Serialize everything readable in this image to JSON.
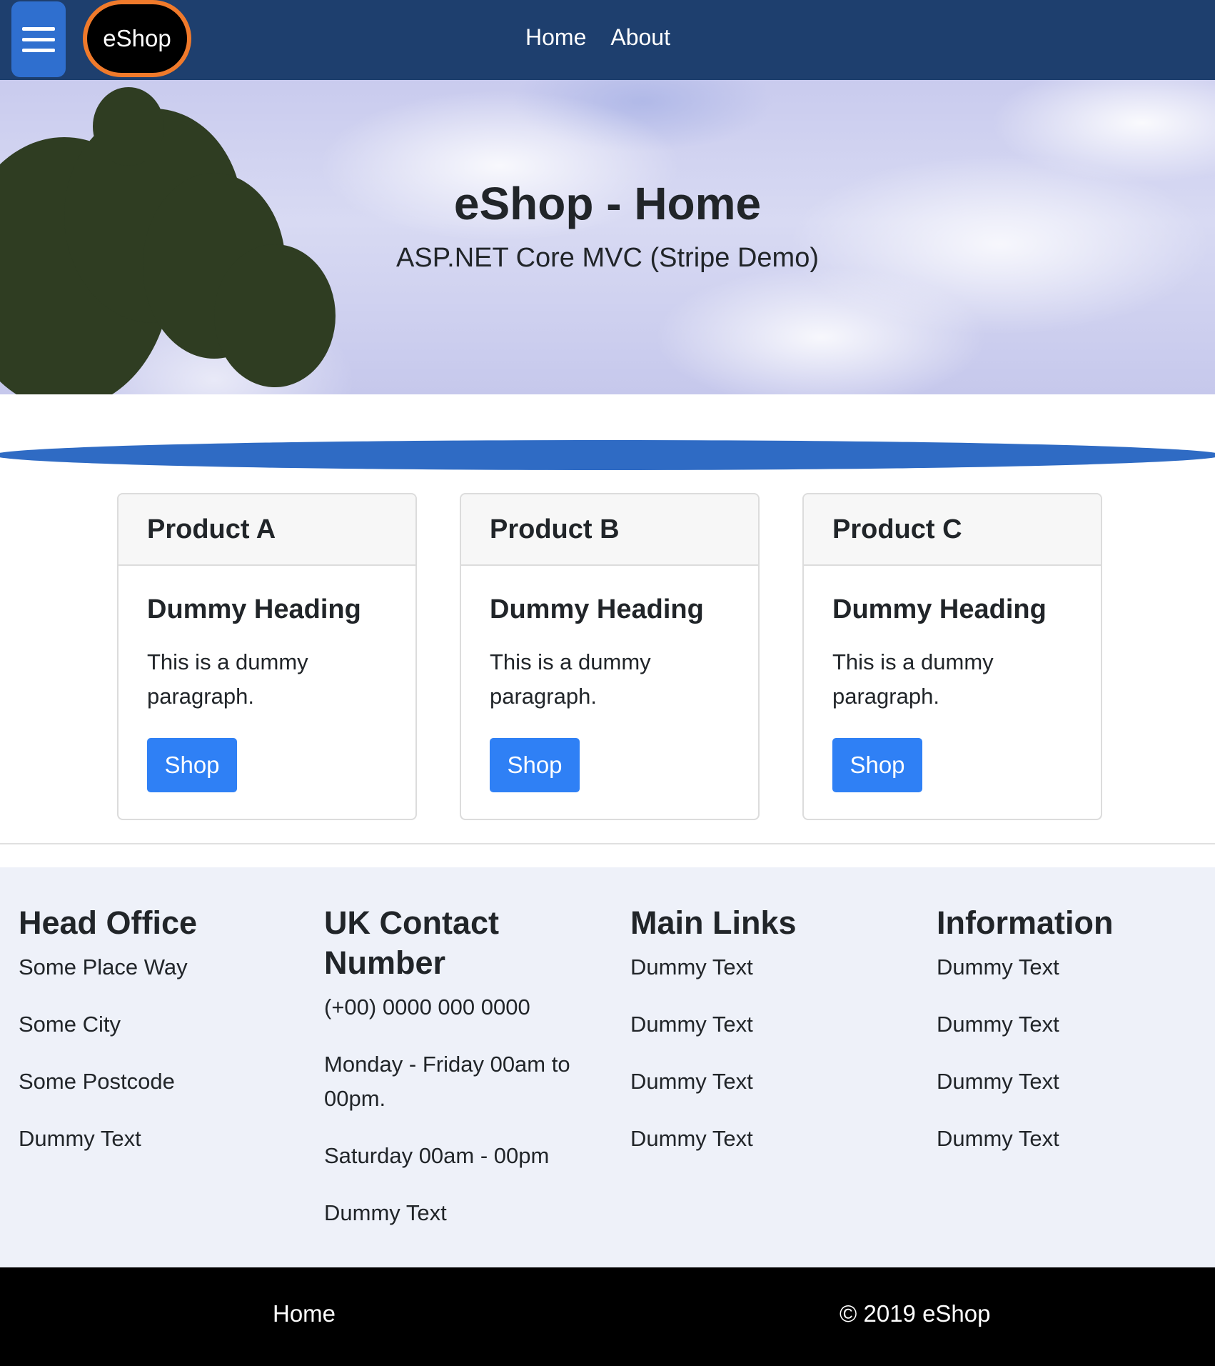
{
  "nav": {
    "brand": "eShop",
    "links": [
      "Home",
      "About"
    ]
  },
  "hero": {
    "title": "eShop - Home",
    "subtitle": "ASP.NET Core MVC (Stripe Demo)"
  },
  "products": [
    {
      "name": "Product A",
      "heading": "Dummy Heading",
      "text": "This is a dummy paragraph.",
      "button": "Shop"
    },
    {
      "name": "Product B",
      "heading": "Dummy Heading",
      "text": "This is a dummy paragraph.",
      "button": "Shop"
    },
    {
      "name": "Product C",
      "heading": "Dummy Heading",
      "text": "This is a dummy paragraph.",
      "button": "Shop"
    }
  ],
  "footer": {
    "head_office": {
      "title": "Head Office",
      "lines": [
        "Some Place Way",
        "Some City",
        "Some Postcode",
        "Dummy Text"
      ]
    },
    "contact": {
      "title": "UK Contact Number",
      "lines": [
        "(+00) 0000 000 0000",
        "Monday - Friday 00am to 00pm.",
        "Saturday 00am - 00pm",
        "Dummy Text"
      ]
    },
    "main_links": {
      "title": "Main Links",
      "lines": [
        "Dummy Text",
        "Dummy Text",
        "Dummy Text",
        "Dummy Text"
      ]
    },
    "information": {
      "title": "Information",
      "lines": [
        "Dummy Text",
        "Dummy Text",
        "Dummy Text",
        "Dummy Text"
      ]
    }
  },
  "bottom_bar": {
    "home": "Home",
    "copyright": "© 2019 eShop"
  },
  "colors": {
    "navbar": "#1e3f6e",
    "menu_button": "#2f6fcf",
    "brand_ring": "#f07a2b",
    "shop_button": "#2f80f5",
    "lens": "#2f6bc4",
    "info_background": "#eef1f9"
  }
}
